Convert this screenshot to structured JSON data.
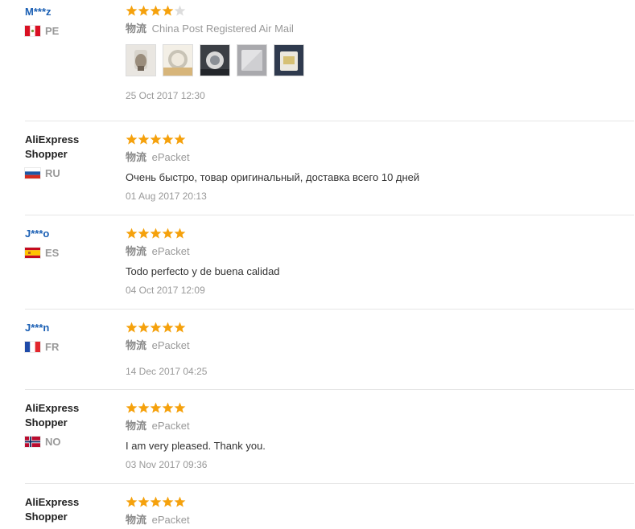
{
  "shipping_label": "物流",
  "star_colors": {
    "filled": "#f5a10c",
    "empty": "#dddddd"
  },
  "reviews": [
    {
      "user": "M***z",
      "user_is_link": true,
      "country_code": "PE",
      "flag_icon": "peru-flag-icon",
      "stars": 4,
      "shipping": "China Post Registered Air Mail",
      "comment": "",
      "photos": [
        "product-photo-1",
        "product-photo-2",
        "product-photo-3",
        "product-photo-4",
        "product-photo-5"
      ],
      "date": "25 Oct 2017 12:30"
    },
    {
      "user": "AliExpress Shopper",
      "user_is_link": false,
      "country_code": "RU",
      "flag_icon": "russia-flag-icon",
      "stars": 5,
      "shipping": "ePacket",
      "comment": "Очень быстро, товар оригинальный, доставка всего 10 дней",
      "photos": [],
      "date": "01 Aug 2017 20:13"
    },
    {
      "user": "J***o",
      "user_is_link": true,
      "country_code": "ES",
      "flag_icon": "spain-flag-icon",
      "stars": 5,
      "shipping": "ePacket",
      "comment": "Todo perfecto y de buena calidad",
      "photos": [],
      "date": "04 Oct 2017 12:09"
    },
    {
      "user": "J***n",
      "user_is_link": true,
      "country_code": "FR",
      "flag_icon": "france-flag-icon",
      "stars": 5,
      "shipping": "ePacket",
      "comment": "",
      "photos": [],
      "date": "14 Dec 2017 04:25"
    },
    {
      "user": "AliExpress Shopper",
      "user_is_link": false,
      "country_code": "NO",
      "flag_icon": "norway-flag-icon",
      "stars": 5,
      "shipping": "ePacket",
      "comment": "I am very pleased. Thank you.",
      "photos": [],
      "date": "03 Nov 2017 09:36"
    },
    {
      "user": "AliExpress Shopper",
      "user_is_link": false,
      "country_code": "",
      "flag_icon": "",
      "stars": 5,
      "shipping": "ePacket",
      "comment": "",
      "photos": [],
      "date": ""
    }
  ]
}
